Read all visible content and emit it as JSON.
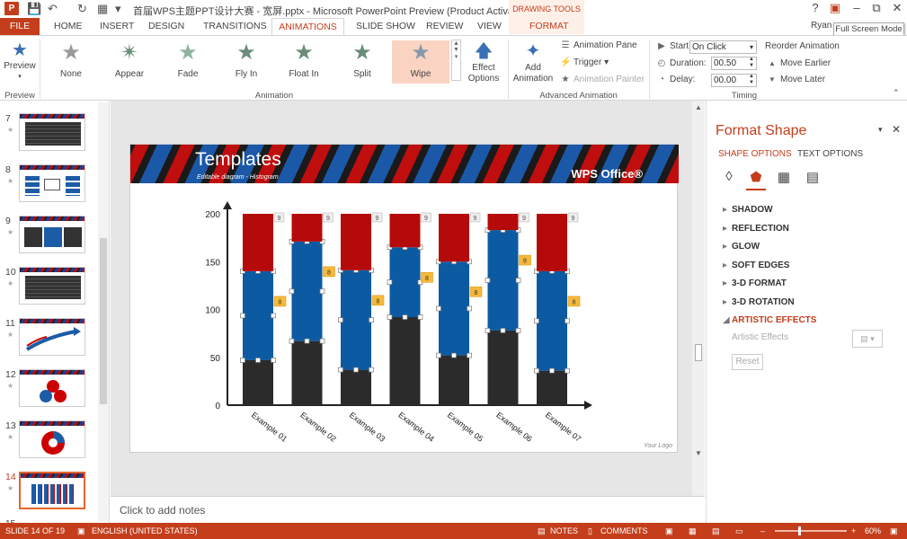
{
  "app": {
    "title": "首届WPS主题PPT设计大赛 - 宽屏.pptx - Microsoft PowerPoint Preview (Product Activation Failed)",
    "drawing_tools": "DRAWING TOOLS",
    "user": "Ryan",
    "tooltip": "Full Screen Mode",
    "accent": "#c43e1c"
  },
  "tabs": [
    "FILE",
    "HOME",
    "INSERT",
    "DESIGN",
    "TRANSITIONS",
    "ANIMATIONS",
    "SLIDE SHOW",
    "REVIEW",
    "VIEW",
    "FORMAT"
  ],
  "ribbon": {
    "preview": {
      "label": "Preview",
      "group": "Preview"
    },
    "animations": [
      {
        "label": "None"
      },
      {
        "label": "Appear"
      },
      {
        "label": "Fade"
      },
      {
        "label": "Fly In"
      },
      {
        "label": "Float In"
      },
      {
        "label": "Split"
      },
      {
        "label": "Wipe"
      }
    ],
    "animation_group": "Animation",
    "effect_options": "Effect Options",
    "add_animation": "Add Animation",
    "animation_pane": "Animation Pane",
    "trigger": "Trigger",
    "animation_painter": "Animation Painter",
    "advanced_group": "Advanced Animation",
    "start_label": "Start:",
    "start_value": "On Click",
    "duration_label": "Duration:",
    "duration_value": "00.50",
    "delay_label": "Delay:",
    "delay_value": "00.00",
    "reorder": "Reorder Animation",
    "move_earlier": "Move Earlier",
    "move_later": "Move Later",
    "timing_group": "Timing"
  },
  "thumbnails": [
    {
      "n": "7"
    },
    {
      "n": "8"
    },
    {
      "n": "9"
    },
    {
      "n": "10"
    },
    {
      "n": "11"
    },
    {
      "n": "12"
    },
    {
      "n": "13"
    },
    {
      "n": "14"
    }
  ],
  "slide": {
    "title": "Templates",
    "subtitle": "Editable diagram - Histogram",
    "brand": "WPS Office®",
    "logo_text": "Your Logo"
  },
  "chart_data": {
    "type": "bar",
    "stacked": true,
    "categories": [
      "Example 01",
      "Example 02",
      "Example 03",
      "Example 04",
      "Example 05",
      "Example 06",
      "Example 07"
    ],
    "series": [
      {
        "color": "#2b2b2b",
        "values": [
          47,
          67,
          37,
          92,
          52,
          78,
          36
        ]
      },
      {
        "color": "#0b5aa2",
        "values": [
          93,
          104,
          104,
          73,
          98,
          105,
          104
        ]
      },
      {
        "color": "#b50a0a",
        "values": [
          60,
          29,
          59,
          35,
          50,
          17,
          60
        ]
      }
    ],
    "ylim": [
      0,
      200
    ],
    "yticks": [
      0,
      50,
      100,
      150,
      200
    ],
    "grid": false,
    "animation_tags": {
      "top": "9",
      "mid": "8"
    }
  },
  "notes": "Click to add notes",
  "format_pane": {
    "title": "Format Shape",
    "tab_shape": "SHAPE OPTIONS",
    "tab_text": "TEXT OPTIONS",
    "sections": [
      "SHADOW",
      "REFLECTION",
      "GLOW",
      "SOFT EDGES",
      "3-D FORMAT",
      "3-D ROTATION",
      "ARTISTIC EFFECTS"
    ],
    "artistic_effects_label": "Artistic Effects",
    "reset": "Reset"
  },
  "status": {
    "slide": "SLIDE 14 OF 19",
    "language": "ENGLISH (UNITED STATES)",
    "notes": "NOTES",
    "comments": "COMMENTS",
    "zoom": "60%"
  }
}
